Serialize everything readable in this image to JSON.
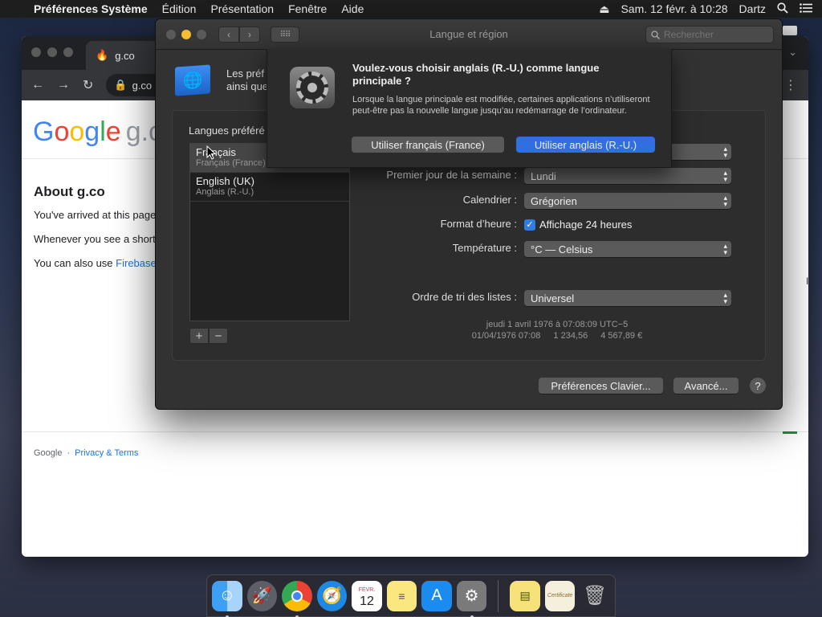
{
  "menubar": {
    "apple_icon": "apple-icon",
    "app_name": "Préférences Système",
    "menus": [
      "Édition",
      "Présentation",
      "Fenêtre",
      "Aide"
    ],
    "datetime": "Sam. 12 févr. à  10:28",
    "user": "Dartz"
  },
  "chrome": {
    "tab_title": "g.co",
    "omnibox_text": "g.co",
    "logo_letters": [
      "G",
      "o",
      "o",
      "g",
      "l",
      "e"
    ],
    "logo_suffix": "g.co",
    "about_title": "About g.co",
    "para1": "You've arrived at this page",
    "para2": "Whenever you see a short",
    "para3_prefix": "You can also use ",
    "para3_link": "Firebase",
    "footer_google": "Google",
    "footer_privacy": "Privacy & Terms",
    "side_char": "l"
  },
  "sysprefs": {
    "window_title": "Langue et région",
    "search_placeholder": "Rechercher",
    "intro_line1": "Les préf",
    "intro_line2": "ainsi que",
    "languages_label": "Langues préféré",
    "languages": [
      {
        "name": "Français",
        "sub": "Français (France)"
      },
      {
        "name": "English (UK)",
        "sub": "Anglais (R.-U.)"
      }
    ],
    "add_label": "+",
    "remove_label": "−",
    "rows": {
      "first_day_label": "Premier jour de la semaine :",
      "first_day_value": "Lundi",
      "calendar_label": "Calendrier :",
      "calendar_value": "Grégorien",
      "time_format_label": "Format d’heure :",
      "time_format_check": "Affichage 24 heures",
      "temperature_label": "Température :",
      "temperature_value": "°C — Celsius",
      "sort_label": "Ordre de tri des listes :",
      "sort_value": "Universel"
    },
    "sample_line1": "jeudi 1 avril 1976 à 07:08:09 UTC−5",
    "sample_line2": [
      "01/04/1976 07:08",
      "1 234,56",
      "4 567,89 €"
    ],
    "keyboard_prefs_button": "Préférences Clavier...",
    "advanced_button": "Avancé...",
    "help_button": "?"
  },
  "alert": {
    "title": "Voulez-vous choisir anglais (R.-U.) comme langue principale ?",
    "message": "Lorsque la langue principale est modifiée, certaines applications n’utiliseront peut-être pas la nouvelle langue jusqu’au redémarrage de l’ordinateur.",
    "secondary_button": "Utiliser français (France)",
    "primary_button": "Utiliser anglais (R.-U.)"
  },
  "dock": {
    "calendar_month": "FÉVR.",
    "calendar_day": "12",
    "cert_label": "Certificate"
  },
  "colors": {
    "accent_blue": "#2f6fe0",
    "minimize_yellow": "#f5bd2f"
  }
}
